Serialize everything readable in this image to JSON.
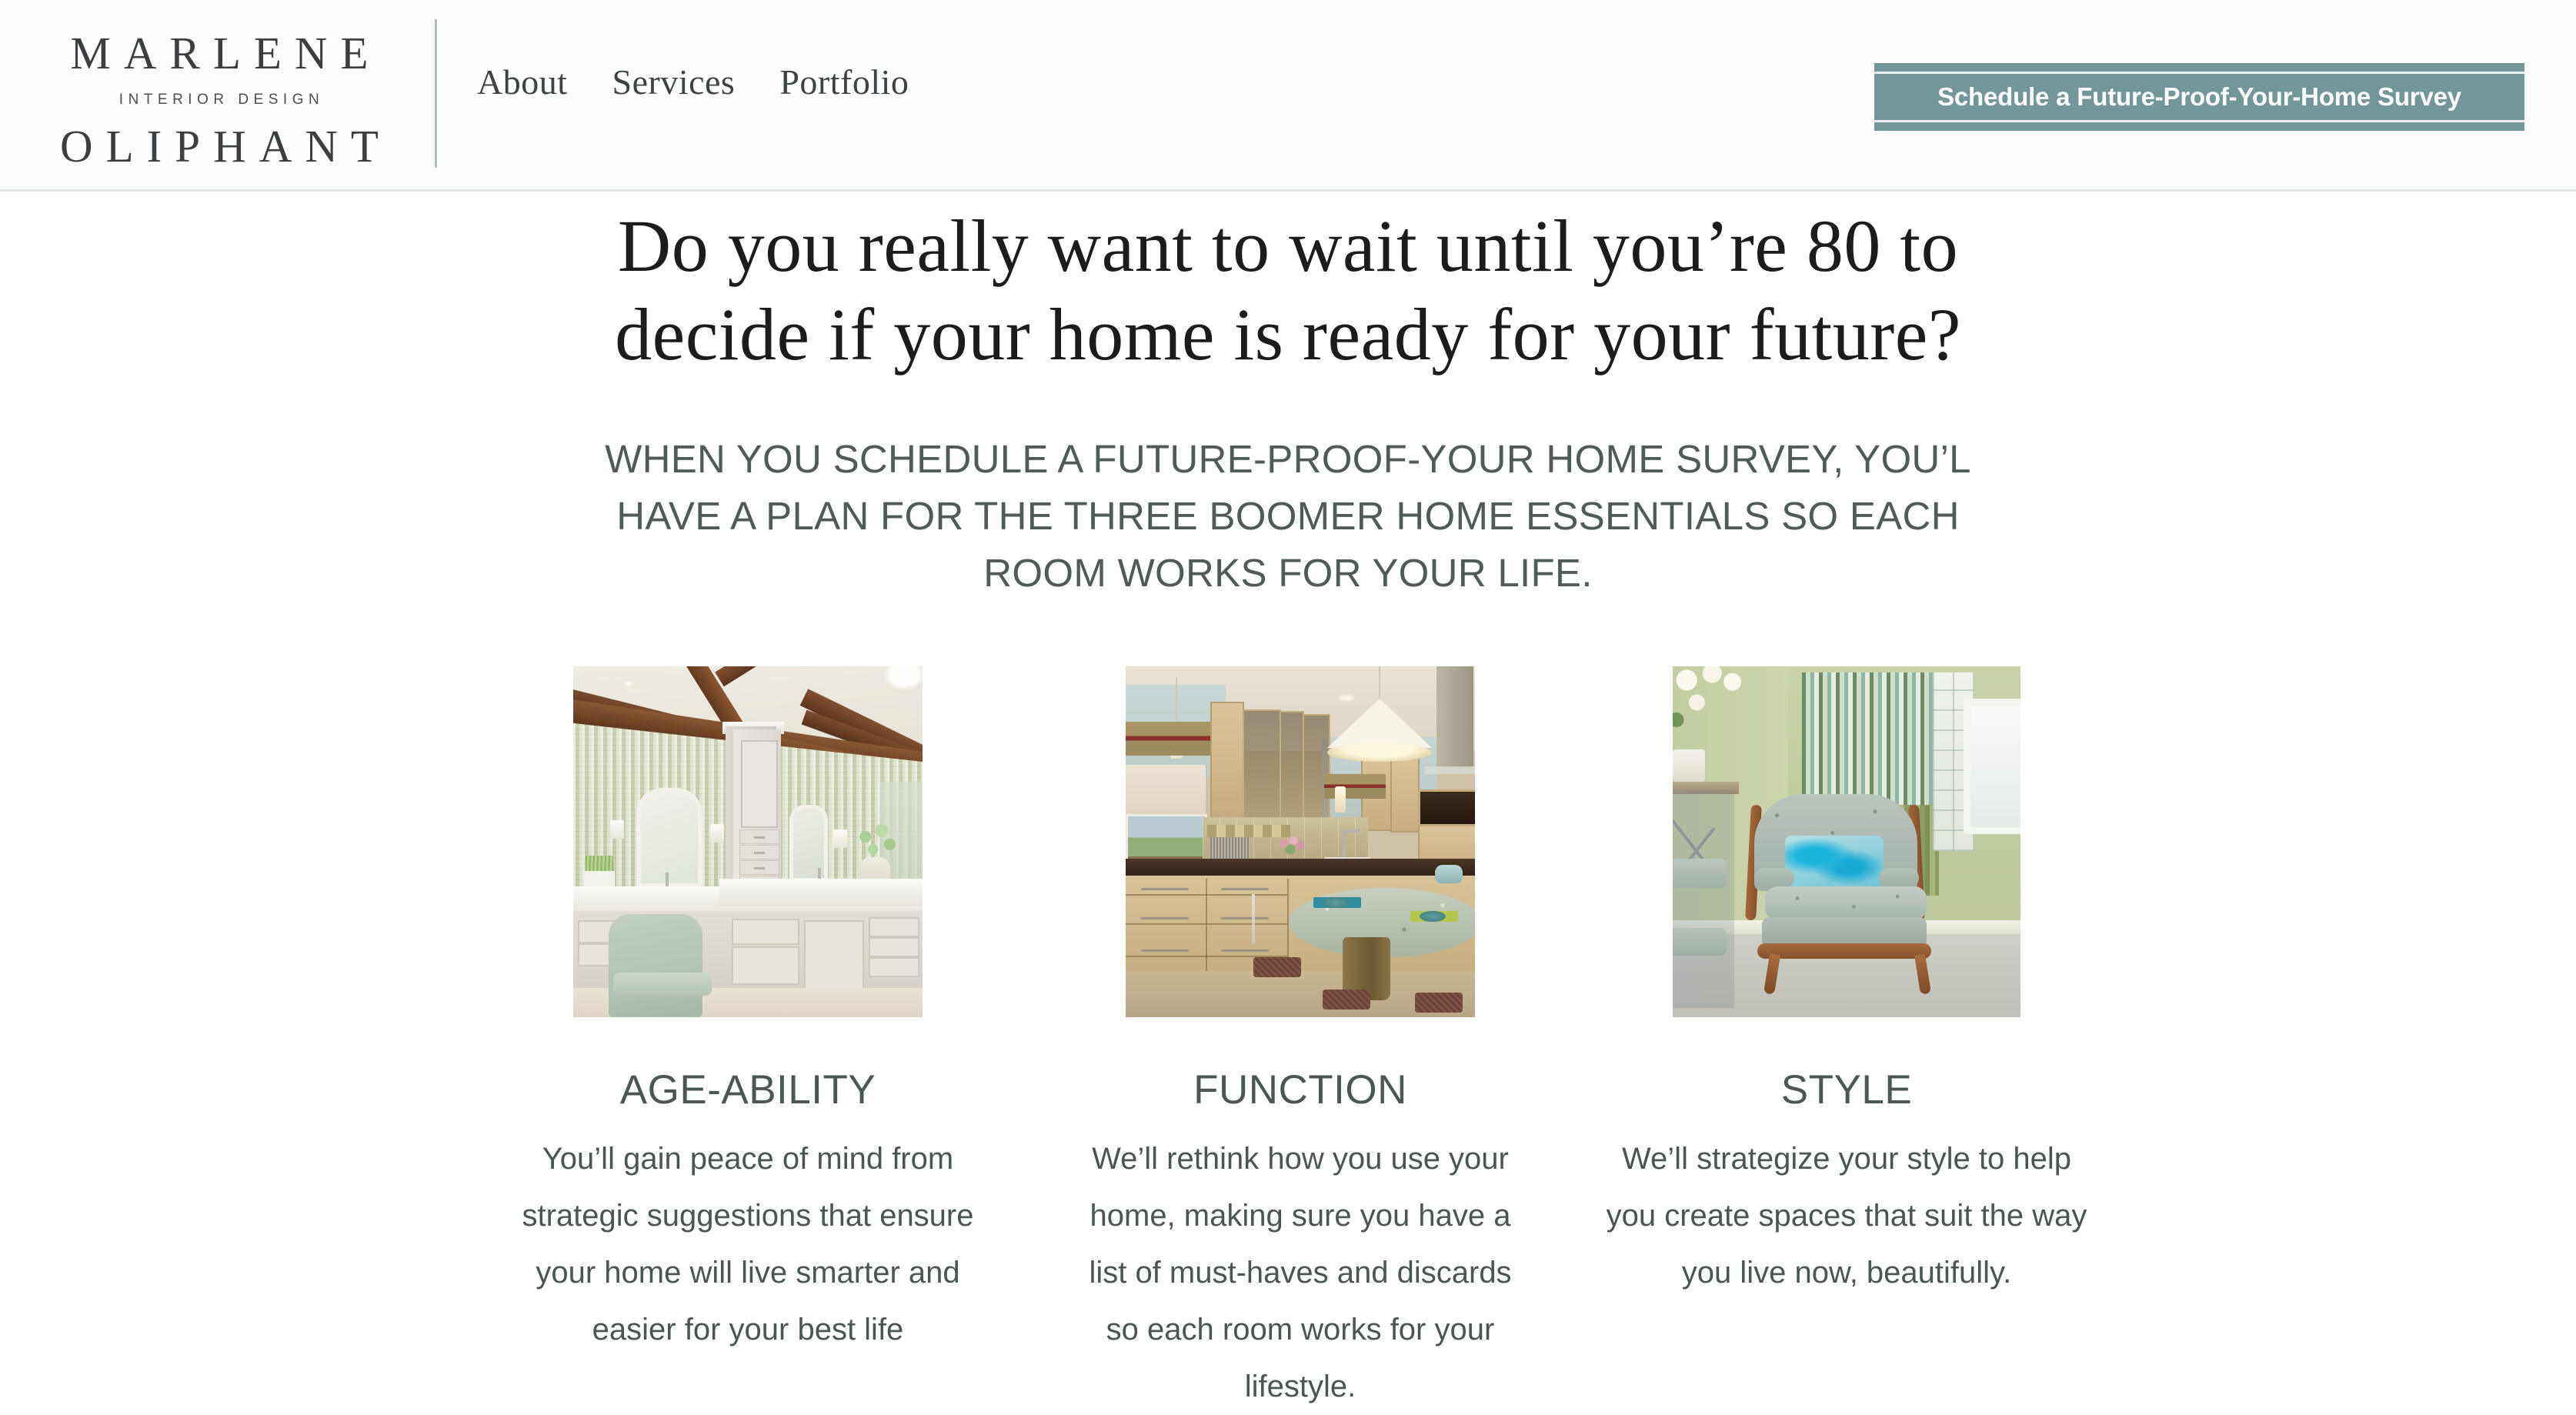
{
  "header": {
    "logo": {
      "line1": "MARLENE",
      "line2": "INTERIOR DESIGN",
      "line3": "OLIPHANT"
    },
    "nav": [
      {
        "label": "About"
      },
      {
        "label": "Services"
      },
      {
        "label": "Portfolio"
      }
    ],
    "cta": {
      "label": "Schedule a Future-Proof-Your-Home Survey",
      "color": "#739799",
      "text_color": "#ffffff"
    },
    "divider_color": "#b4bdbf",
    "bottom_border_color": "#dde3e6"
  },
  "hero": {
    "headline_lines": [
      "Do you really want to wait until you’re 80 to",
      "decide if your home is ready for your future?"
    ],
    "subhead_lines": [
      "WHEN YOU SCHEDULE A FUTURE-PROOF-YOUR HOME SURVEY, YOU’L",
      "HAVE A PLAN FOR THE THREE BOOMER HOME ESSENTIALS SO EACH",
      "ROOM WORKS FOR YOUR LIFE."
    ],
    "headline_color": "#1c1c1c",
    "subhead_color": "#4f5a59"
  },
  "columns": [
    {
      "image_alt": "luxury-bathroom-vanity-photo",
      "title": "AGE-ABILITY",
      "body": "You’ll gain peace of mind from strategic suggestions that ensure your home will live smarter and easier for your best life"
    },
    {
      "image_alt": "maple-kitchen-island-photo",
      "title": "FUNCTION",
      "body": "We’ll rethink how you use your home, making sure you have a list of must-haves and discards so each room works for your lifestyle."
    },
    {
      "image_alt": "green-sitting-room-armchair-photo",
      "title": "STYLE",
      "body": "We’ll strategize your style to help you create spaces that suit the way you live now, beautifully."
    }
  ],
  "theme": {
    "page_background": "#ffffff",
    "body_text_color": "#4b5554"
  }
}
